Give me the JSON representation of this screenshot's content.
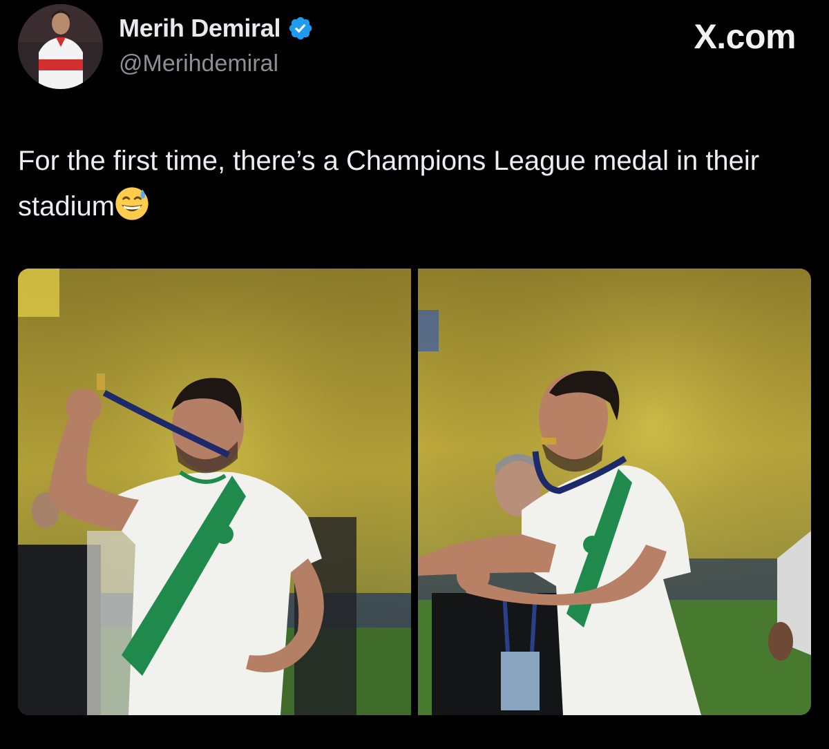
{
  "header": {
    "display_name": "Merih Demiral",
    "handle": "@Merihdemiral",
    "verified_icon": "verified-badge-icon",
    "brand": "X.com"
  },
  "tweet": {
    "text": "For the first time, there’s a Champions League medal in their stadium",
    "emoji": "grinning-face-with-sweat"
  },
  "media": {
    "count": 2
  },
  "colors": {
    "background": "#000000",
    "verified_blue": "#1d9bf0",
    "kit_green": "#1f8a4c",
    "crowd_yellow": "#c9b533"
  }
}
